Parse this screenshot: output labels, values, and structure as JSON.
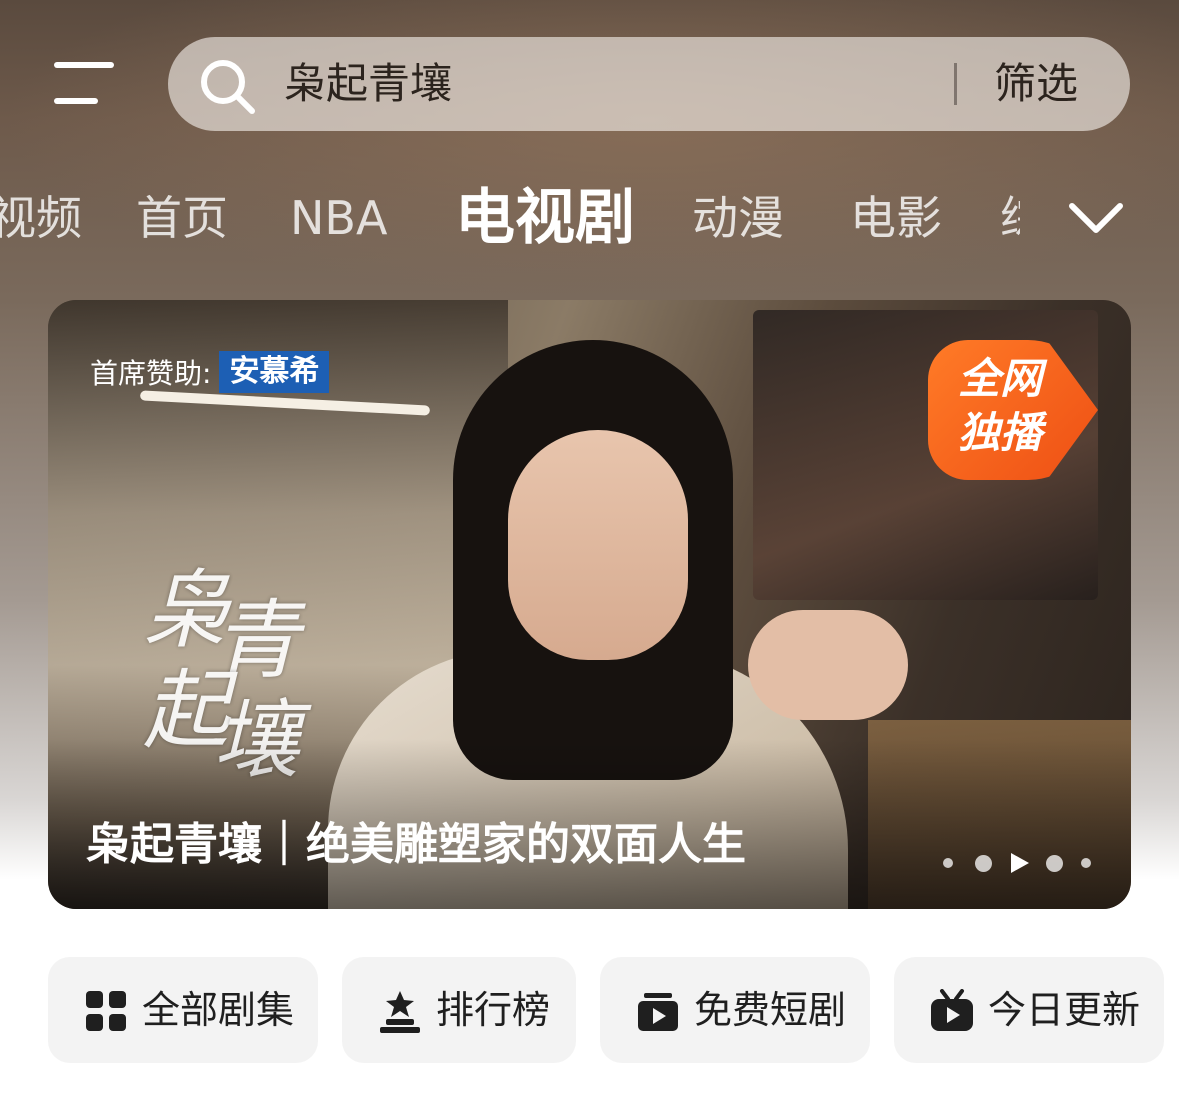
{
  "search": {
    "query": "枭起青壤",
    "filter_label": "筛选"
  },
  "tabs": [
    {
      "label": "视频",
      "active": false
    },
    {
      "label": "首页",
      "active": false
    },
    {
      "label": "NBA",
      "active": false
    },
    {
      "label": "电视剧",
      "active": true
    },
    {
      "label": "动漫",
      "active": false
    },
    {
      "label": "电影",
      "active": false
    },
    {
      "label": "综",
      "active": false
    }
  ],
  "banner": {
    "sponsor_label": "首席赞助:",
    "sponsor_brand": "安慕希",
    "calligraphy": [
      "枭",
      "青",
      "起",
      "壤"
    ],
    "badge_text": "全网独播",
    "caption": "枭起青壤｜绝美雕塑家的双面人生",
    "carousel": {
      "total": 5,
      "current": 3
    }
  },
  "quick_entries": [
    {
      "label": "全部剧集",
      "icon": "grid-icon"
    },
    {
      "label": "排行榜",
      "icon": "ranking-icon"
    },
    {
      "label": "免费短剧",
      "icon": "short-drama-icon"
    },
    {
      "label": "今日更新",
      "icon": "tv-play-icon"
    }
  ],
  "colors": {
    "badge_orange": "#f05a18",
    "sponsor_blue": "#1d5fb4"
  }
}
